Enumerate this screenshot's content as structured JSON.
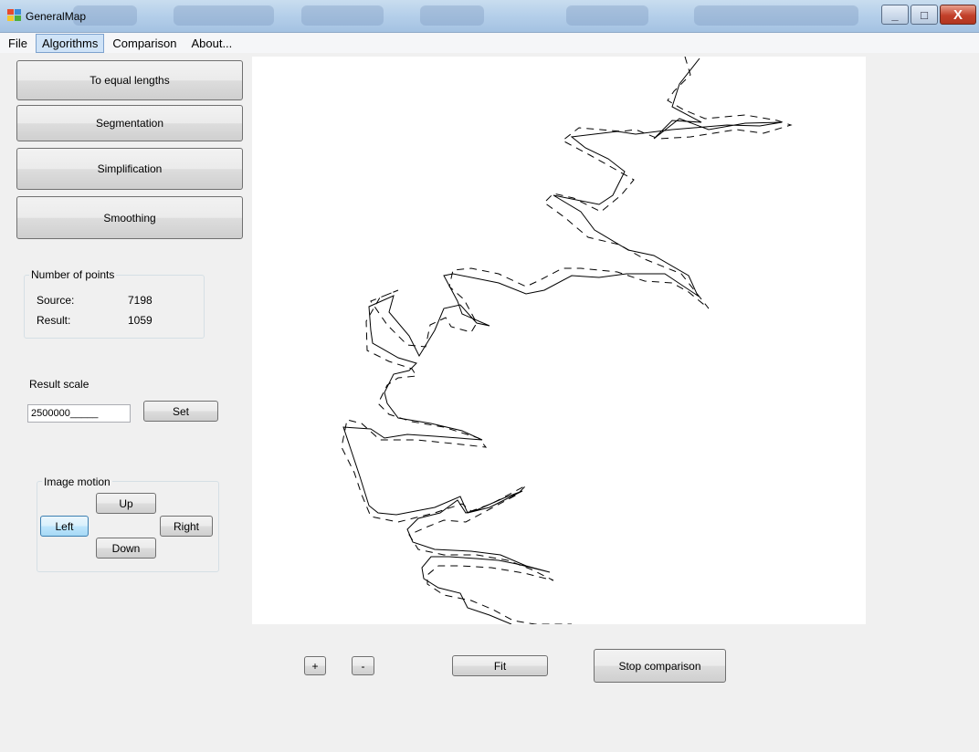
{
  "window": {
    "title": "GeneralMap",
    "minimize_glyph": "_",
    "maximize_glyph": "□",
    "close_glyph": "X"
  },
  "menu": {
    "items": [
      {
        "label": "File"
      },
      {
        "label": "Algorithms"
      },
      {
        "label": "Comparison"
      },
      {
        "label": "About..."
      }
    ]
  },
  "algorithms": {
    "equal_lengths": "To equal lengths",
    "segmentation": "Segmentation",
    "simplification": "Simplification",
    "smoothing": "Smoothing"
  },
  "points": {
    "title": "Number of points",
    "source_label": "Source:",
    "source_value": "7198",
    "result_label": "Result:",
    "result_value": "1059"
  },
  "scale": {
    "label": "Result scale",
    "value": "2500000_____",
    "set_button": "Set"
  },
  "motion": {
    "title": "Image motion",
    "up": "Up",
    "left": "Left",
    "right": "Right",
    "down": "Down"
  },
  "bottom": {
    "zoom_in": "+",
    "zoom_out": "-",
    "fit": "Fit",
    "stop_comparison": "Stop comparison"
  },
  "colors": {
    "canvas_bg": "#ffffff",
    "line": "#000000",
    "window_bg": "#f0f0f0",
    "menu_active": "#cfe3f7"
  },
  "icons": {
    "app": "app-map-icon",
    "minimize": "minimize-icon",
    "maximize": "maximize-icon",
    "close": "close-icon"
  }
}
